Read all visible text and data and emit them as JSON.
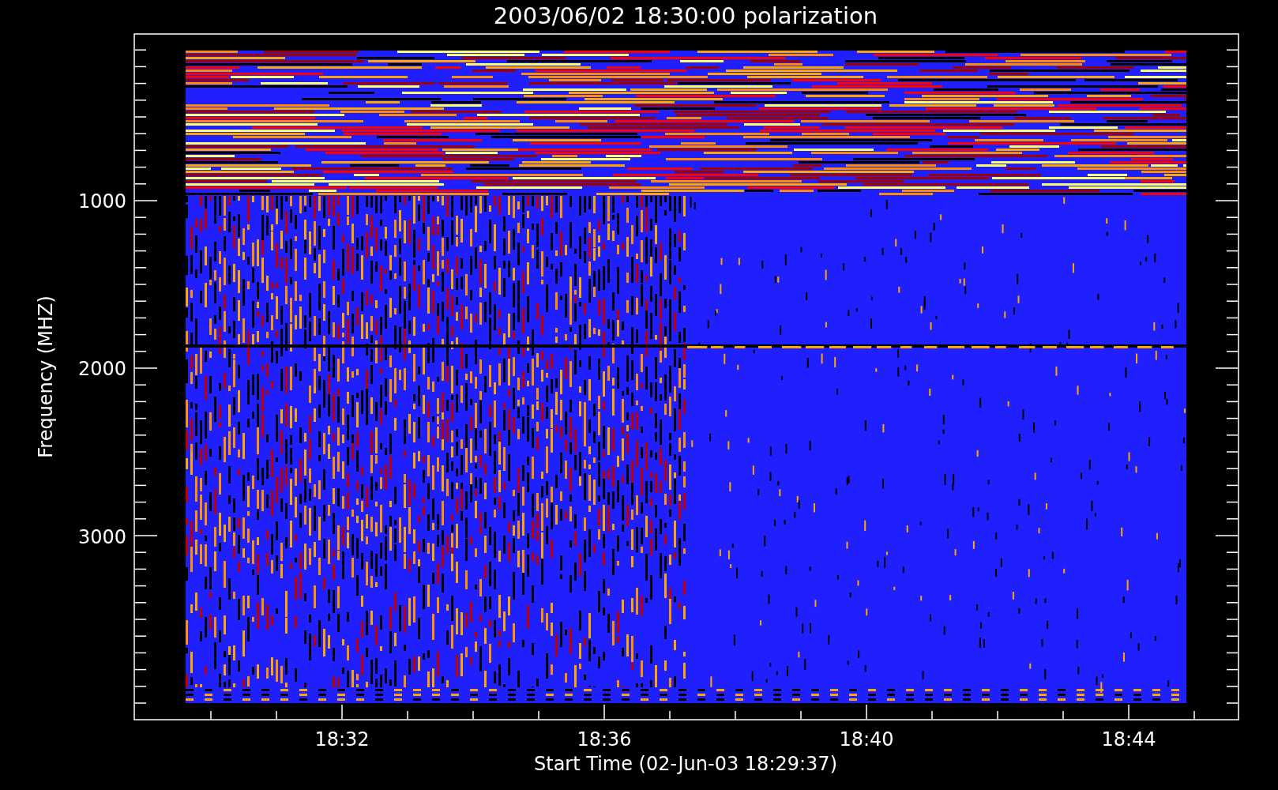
{
  "title": "2003/06/02 18:30:00 polarization",
  "y_axis": {
    "label": "Frequency (MHZ)",
    "ticks": [
      "1000",
      "2000",
      "3000"
    ]
  },
  "x_axis": {
    "label": "Start Time (02-Jun-03 18:29:37)",
    "ticks": [
      "18:32",
      "18:36",
      "18:40",
      "18:44"
    ]
  }
}
